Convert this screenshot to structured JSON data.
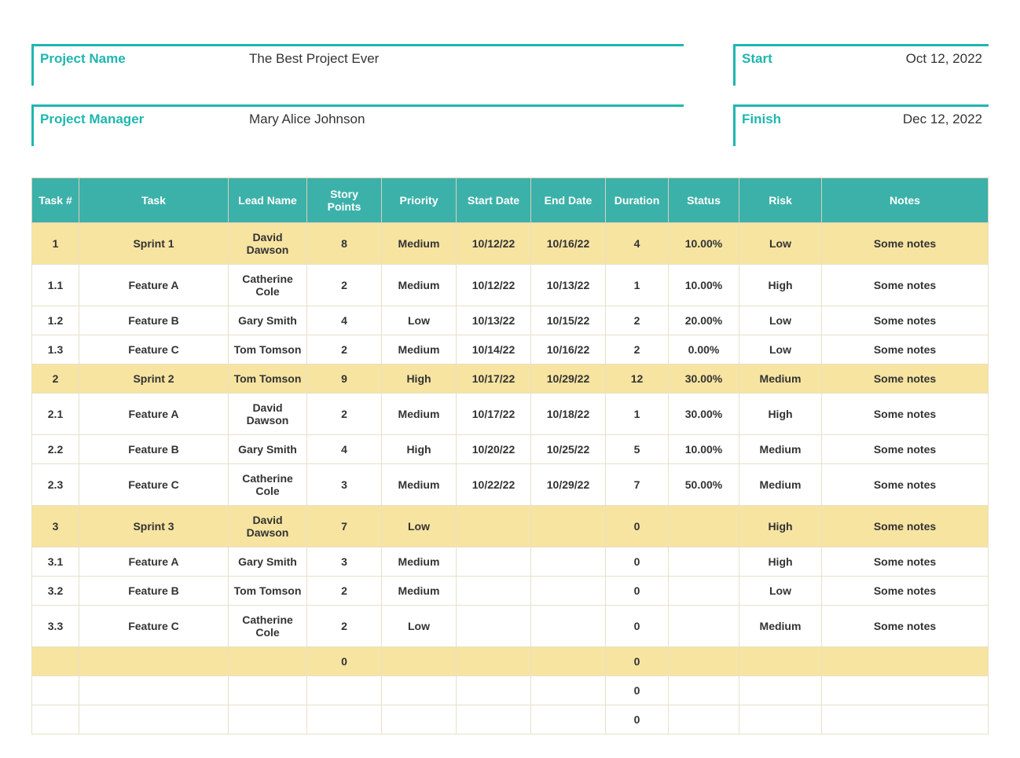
{
  "meta": {
    "project_name_label": "Project Name",
    "project_name_value": "The Best Project Ever",
    "project_manager_label": "Project Manager",
    "project_manager_value": "Mary Alice Johnson",
    "start_label": "Start",
    "start_value": "Oct 12, 2022",
    "finish_label": "Finish",
    "finish_value": "Dec 12, 2022"
  },
  "columns": {
    "task_num": "Task #",
    "task": "Task",
    "lead": "Lead Name",
    "points": "Story Points",
    "priority": "Priority",
    "start": "Start Date",
    "end": "End Date",
    "duration": "Duration",
    "status": "Status",
    "risk": "Risk",
    "notes": "Notes"
  },
  "rows": [
    {
      "type": "sprint",
      "num": "1",
      "task": "Sprint 1",
      "lead": "David Dawson",
      "points": "8",
      "priority": "Medium",
      "start": "10/12/22",
      "end": "10/16/22",
      "duration": "4",
      "status": "10.00%",
      "risk": "Low",
      "notes": "Some notes"
    },
    {
      "type": "feature",
      "num": "1.1",
      "task": "Feature A",
      "lead": "Catherine Cole",
      "points": "2",
      "priority": "Medium",
      "start": "10/12/22",
      "end": "10/13/22",
      "duration": "1",
      "status": "10.00%",
      "risk": "High",
      "notes": "Some notes"
    },
    {
      "type": "feature",
      "num": "1.2",
      "task": "Feature B",
      "lead": "Gary Smith",
      "points": "4",
      "priority": "Low",
      "start": "10/13/22",
      "end": "10/15/22",
      "duration": "2",
      "status": "20.00%",
      "risk": "Low",
      "notes": "Some notes"
    },
    {
      "type": "feature",
      "num": "1.3",
      "task": "Feature C",
      "lead": "Tom Tomson",
      "points": "2",
      "priority": "Medium",
      "start": "10/14/22",
      "end": "10/16/22",
      "duration": "2",
      "status": "0.00%",
      "risk": "Low",
      "notes": "Some notes"
    },
    {
      "type": "sprint",
      "num": "2",
      "task": "Sprint 2",
      "lead": "Tom Tomson",
      "points": "9",
      "priority": "High",
      "start": "10/17/22",
      "end": "10/29/22",
      "duration": "12",
      "status": "30.00%",
      "risk": "Medium",
      "notes": "Some notes"
    },
    {
      "type": "feature",
      "num": "2.1",
      "task": "Feature A",
      "lead": "David Dawson",
      "points": "2",
      "priority": "Medium",
      "start": "10/17/22",
      "end": "10/18/22",
      "duration": "1",
      "status": "30.00%",
      "risk": "High",
      "notes": "Some notes"
    },
    {
      "type": "feature",
      "num": "2.2",
      "task": "Feature B",
      "lead": "Gary Smith",
      "points": "4",
      "priority": "High",
      "start": "10/20/22",
      "end": "10/25/22",
      "duration": "5",
      "status": "10.00%",
      "risk": "Medium",
      "notes": "Some notes"
    },
    {
      "type": "feature",
      "num": "2.3",
      "task": "Feature C",
      "lead": "Catherine Cole",
      "points": "3",
      "priority": "Medium",
      "start": "10/22/22",
      "end": "10/29/22",
      "duration": "7",
      "status": "50.00%",
      "risk": "Medium",
      "notes": "Some notes"
    },
    {
      "type": "sprint",
      "num": "3",
      "task": "Sprint 3",
      "lead": "David Dawson",
      "points": "7",
      "priority": "Low",
      "start": "",
      "end": "",
      "duration": "0",
      "status": "",
      "risk": "High",
      "notes": "Some notes"
    },
    {
      "type": "feature",
      "num": "3.1",
      "task": "Feature A",
      "lead": "Gary Smith",
      "points": "3",
      "priority": "Medium",
      "start": "",
      "end": "",
      "duration": "0",
      "status": "",
      "risk": "High",
      "notes": "Some notes"
    },
    {
      "type": "feature",
      "num": "3.2",
      "task": "Feature B",
      "lead": "Tom Tomson",
      "points": "2",
      "priority": "Medium",
      "start": "",
      "end": "",
      "duration": "0",
      "status": "",
      "risk": "Low",
      "notes": "Some notes"
    },
    {
      "type": "feature",
      "num": "3.3",
      "task": "Feature C",
      "lead": "Catherine Cole",
      "points": "2",
      "priority": "Low",
      "start": "",
      "end": "",
      "duration": "0",
      "status": "",
      "risk": "Medium",
      "notes": "Some notes"
    },
    {
      "type": "empty-sprint",
      "num": "",
      "task": "",
      "lead": "",
      "points": "0",
      "priority": "",
      "start": "",
      "end": "",
      "duration": "0",
      "status": "",
      "risk": "",
      "notes": ""
    },
    {
      "type": "empty",
      "num": "",
      "task": "",
      "lead": "",
      "points": "",
      "priority": "",
      "start": "",
      "end": "",
      "duration": "0",
      "status": "",
      "risk": "",
      "notes": ""
    },
    {
      "type": "empty",
      "num": "",
      "task": "",
      "lead": "",
      "points": "",
      "priority": "",
      "start": "",
      "end": "",
      "duration": "0",
      "status": "",
      "risk": "",
      "notes": ""
    }
  ]
}
